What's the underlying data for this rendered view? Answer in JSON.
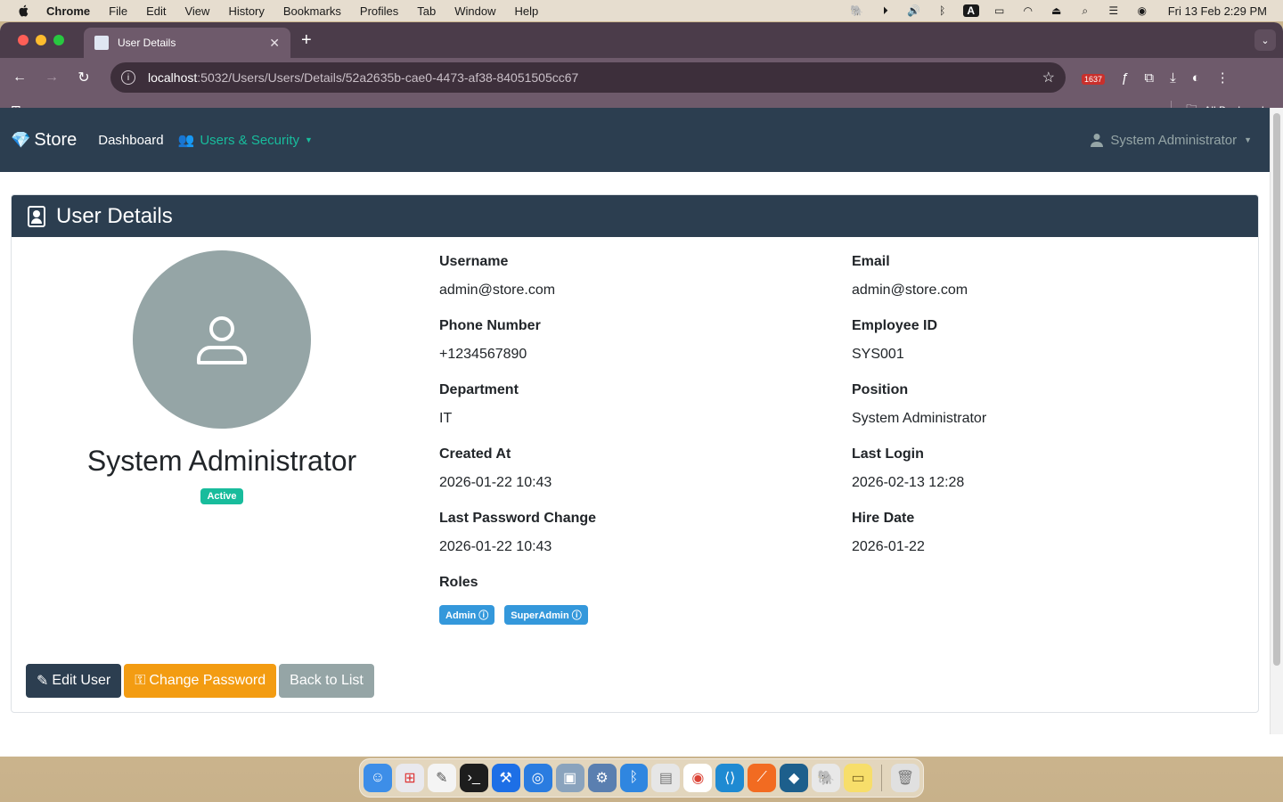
{
  "menubar": {
    "app": "Chrome",
    "items": [
      "File",
      "Edit",
      "View",
      "History",
      "Bookmarks",
      "Profiles",
      "Tab",
      "Window",
      "Help"
    ],
    "clock": "Fri 13 Feb  2:29 PM"
  },
  "browser": {
    "tab_title": "User Details",
    "url_host": "localhost",
    "url_path": ":5032/Users/Users/Details/52a2635b-cae0-4473-af38-84051505cc67",
    "extension_badge": "1637",
    "all_bookmarks": "All Bookmarks"
  },
  "navbar": {
    "brand": "Store",
    "dashboard": "Dashboard",
    "users_security": "Users & Security",
    "user_menu": "System Administrator"
  },
  "card": {
    "title": "User Details"
  },
  "profile": {
    "name": "System Administrator",
    "status": "Active"
  },
  "fields": {
    "username_label": "Username",
    "username": "admin@store.com",
    "email_label": "Email",
    "email": "admin@store.com",
    "phone_label": "Phone Number",
    "phone": "+1234567890",
    "employee_id_label": "Employee ID",
    "employee_id": "SYS001",
    "department_label": "Department",
    "department": "IT",
    "position_label": "Position",
    "position": "System Administrator",
    "created_label": "Created At",
    "created": "2026-01-22 10:43",
    "last_login_label": "Last Login",
    "last_login": "2026-02-13 12:28",
    "last_pw_label": "Last Password Change",
    "last_pw": "2026-01-22 10:43",
    "hire_label": "Hire Date",
    "hire": "2026-01-22",
    "roles_label": "Roles",
    "roles": [
      "Admin ⓘ",
      "SuperAdmin ⓘ"
    ]
  },
  "actions": {
    "edit": "Edit User",
    "change_password": "Change Password",
    "back": "Back to List"
  },
  "colors": {
    "navbar": "#2c3e50",
    "success": "#18bc9c",
    "info": "#3498db",
    "warning": "#f39c12",
    "secondary": "#95a5a6"
  }
}
